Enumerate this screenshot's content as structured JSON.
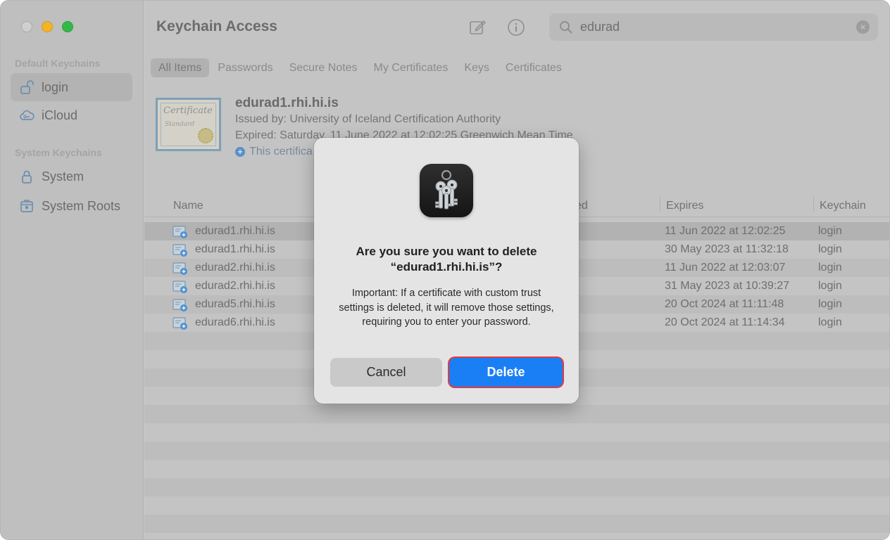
{
  "window": {
    "title": "Keychain Access"
  },
  "sidebar": {
    "default_header": "Default Keychains",
    "system_header": "System Keychains",
    "items": [
      {
        "label": "login",
        "icon": "lock-open-icon"
      },
      {
        "label": "iCloud",
        "icon": "cloud-key-icon"
      },
      {
        "label": "System",
        "icon": "lock-icon"
      },
      {
        "label": "System Roots",
        "icon": "cabinet-lock-icon"
      }
    ]
  },
  "toolbar": {
    "compose_icon": "compose-icon",
    "info_icon": "info-icon"
  },
  "search": {
    "value": "edurad",
    "placeholder": "Search"
  },
  "tabs": [
    "All Items",
    "Passwords",
    "Secure Notes",
    "My Certificates",
    "Keys",
    "Certificates"
  ],
  "detail": {
    "name": "edurad1.rhi.hi.is",
    "issued_by": "Issued by: University of Iceland Certification Authority",
    "expired": "Expired: Saturday, 11 June 2022 at 12:02:25 Greenwich Mean Time",
    "trust": "This certifica",
    "cert_image_text_1": "Certificate",
    "cert_image_text_2": "Standard"
  },
  "columns": {
    "name": "Name",
    "partial": "ed",
    "expires": "Expires",
    "keychain": "Keychain"
  },
  "rows": [
    {
      "name": "edurad1.rhi.hi.is",
      "expires": "11 Jun 2022 at 12:02:25",
      "keychain": "login"
    },
    {
      "name": "edurad1.rhi.hi.is",
      "expires": "30 May 2023 at 11:32:18",
      "keychain": "login"
    },
    {
      "name": "edurad2.rhi.hi.is",
      "expires": "11 Jun 2022 at 12:03:07",
      "keychain": "login"
    },
    {
      "name": "edurad2.rhi.hi.is",
      "expires": "31 May 2023 at 10:39:27",
      "keychain": "login"
    },
    {
      "name": "edurad5.rhi.hi.is",
      "expires": "20 Oct 2024 at 11:11:48",
      "keychain": "login"
    },
    {
      "name": "edurad6.rhi.hi.is",
      "expires": "20 Oct 2024 at 11:14:34",
      "keychain": "login"
    }
  ],
  "dialog": {
    "title_line1": "Are you sure you want to delete",
    "title_line2": "“edurad1.rhi.hi.is”?",
    "body": "Important: If a certificate with custom trust settings is deleted, it will remove those settings, requiring you to enter your password.",
    "cancel_label": "Cancel",
    "delete_label": "Delete",
    "accent_color": "#1a7ff5"
  }
}
